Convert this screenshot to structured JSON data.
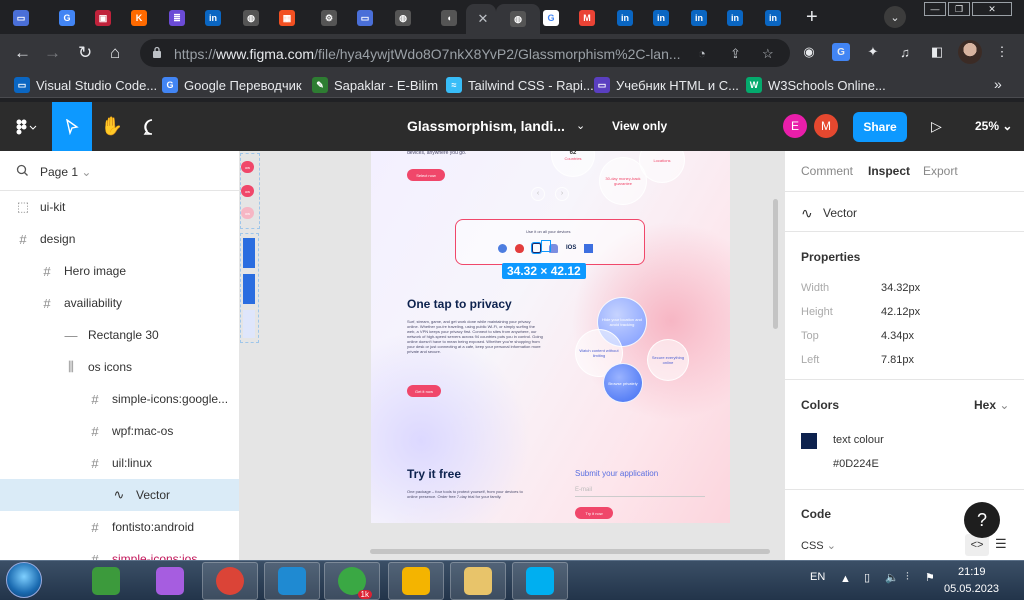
{
  "browser": {
    "tabs": [
      {
        "icon": "laptop-icon",
        "color": "#4a6fd8",
        "glyph": "▭"
      },
      {
        "icon": "google-translate-icon",
        "color": "#4285f4",
        "glyph": "G"
      },
      {
        "icon": "figma-like-icon",
        "color": "#c0223b",
        "glyph": "▣"
      },
      {
        "icon": "k-icon",
        "color": "#ff6a00",
        "glyph": "K"
      },
      {
        "icon": "list-icon",
        "color": "#6b4bd6",
        "glyph": "≣"
      },
      {
        "icon": "linkedin-icon",
        "color": "#0a66c2",
        "glyph": "in"
      },
      {
        "icon": "globe-icon",
        "color": "#555",
        "glyph": "◍"
      },
      {
        "icon": "microsoft-icon",
        "color": "#f25022",
        "glyph": "▦"
      },
      {
        "icon": "gear-icon",
        "color": "#555",
        "glyph": "⚙"
      },
      {
        "icon": "laptop-icon",
        "color": "#4a6fd8",
        "glyph": "▭"
      },
      {
        "icon": "globe-icon",
        "color": "#555",
        "glyph": "◍"
      },
      {
        "icon": "speaker-icon",
        "color": "#555",
        "glyph": "◖"
      },
      {
        "icon": "globe-icon",
        "color": "#555",
        "glyph": "◍"
      },
      {
        "icon": "google-icon",
        "color": "#fff",
        "glyph": "G"
      },
      {
        "icon": "gmail-icon",
        "color": "#ea4335",
        "glyph": "M"
      },
      {
        "icon": "linkedin-icon",
        "color": "#0a66c2",
        "glyph": "in"
      },
      {
        "icon": "linkedin-icon",
        "color": "#0a66c2",
        "glyph": "in"
      },
      {
        "icon": "linkedin-icon",
        "color": "#0a66c2",
        "glyph": "in"
      },
      {
        "icon": "linkedin-icon",
        "color": "#0a66c2",
        "glyph": "in"
      },
      {
        "icon": "linkedin-icon",
        "color": "#0a66c2",
        "glyph": "in"
      }
    ],
    "url_prefix": "https://",
    "url_host": "www.figma.com",
    "url_path": "/file/hya4ywjtWdo8O7nkX8YvP2/Glassmorphism%2C-lan...",
    "bookmarks": [
      {
        "label": "Visual Studio Code...",
        "color": "#0a66c2",
        "glyph": "▭"
      },
      {
        "label": "Google Переводчик",
        "color": "#4285f4",
        "glyph": "G"
      },
      {
        "label": "Sapaklar - E-Bilim",
        "color": "#2e7d32",
        "glyph": "✎"
      },
      {
        "label": "Tailwind CSS - Rapi...",
        "color": "#38bdf8",
        "glyph": "≈"
      },
      {
        "label": "Учебник HTML и C...",
        "color": "#5a3fc0",
        "glyph": "▭"
      },
      {
        "label": "W3Schools Online...",
        "color": "#04aa6d",
        "glyph": "W"
      }
    ],
    "bookmarks_more": "»"
  },
  "figma": {
    "file_title": "Glassmorphism, landi...",
    "view_mode": "View only",
    "avatars": [
      "E",
      "M"
    ],
    "share_label": "Share",
    "zoom": "25%",
    "page_selector": "Page 1",
    "layers": [
      {
        "name": "ui-kit",
        "icon": "dashed-frame-icon",
        "glyph": "⬚",
        "indent": 0
      },
      {
        "name": "design",
        "icon": "frame-icon",
        "glyph": "#",
        "indent": 0
      },
      {
        "name": "Hero image",
        "icon": "frame-icon",
        "glyph": "#",
        "indent": 1
      },
      {
        "name": "availiability",
        "icon": "frame-icon",
        "glyph": "#",
        "indent": 1
      },
      {
        "name": "Rectangle 30",
        "icon": "rectangle-icon",
        "glyph": "—",
        "indent": 2
      },
      {
        "name": "os icons",
        "icon": "auto-layout-icon",
        "glyph": "⫼",
        "indent": 2
      },
      {
        "name": "simple-icons:google...",
        "icon": "frame-icon",
        "glyph": "#",
        "indent": 3
      },
      {
        "name": "wpf:mac-os",
        "icon": "frame-icon",
        "glyph": "#",
        "indent": 3
      },
      {
        "name": "uil:linux",
        "icon": "frame-icon",
        "glyph": "#",
        "indent": 3
      },
      {
        "name": "Vector",
        "icon": "vector-icon",
        "glyph": "∿",
        "indent": 4,
        "selected": true
      },
      {
        "name": "fontisto:android",
        "icon": "frame-icon",
        "glyph": "#",
        "indent": 3
      },
      {
        "name": "simple-icons:ios",
        "icon": "frame-icon",
        "glyph": "#",
        "indent": 3
      }
    ],
    "selection_size": "34.32 × 42.12"
  },
  "design": {
    "hero_tail_text": "devices, anywhere you go.",
    "hero_btn": "Select now",
    "countries_card": "Countries",
    "countries_num": "62",
    "moneyback_card": "30-day money-back guarantee",
    "locations_card": "Locations",
    "devices_caption": "Use it on all your devices",
    "os_ios": "IOS",
    "privacy_title": "One tap to privacy",
    "privacy_body": "Surf, stream, game, and get work done while maintaining your privacy online. Whether you're traveling, using public Wi-Fi, or simply surfing the web, a VPN keeps your privacy first. Connect to sites from anywhere, our network of high-speed servers across 94 countries puts you in control. Going online doesn't have to mean being exposed. Whether you're shopping from your desk or just connecting at a cafe, keep your personal information more private and secure.",
    "privacy_btn": "Get it now",
    "bubbles": [
      "Hide your location and avoid tracking",
      "Watch content without limiting",
      "Secure everything online",
      "Browse privately"
    ],
    "try_title": "Try it free",
    "try_body": "One package – four tools to protect yourself, from your devices to online presence. Order free 7-day trial for your family.",
    "submit_title": "Submit your application",
    "email_placeholder": "E-mail",
    "try_btn": "Try it now"
  },
  "inspect": {
    "tabs": [
      "Comment",
      "Inspect",
      "Export"
    ],
    "active_tab": "Inspect",
    "layer_name": "Vector",
    "properties_title": "Properties",
    "properties": [
      {
        "k": "Width",
        "v": "34.32px"
      },
      {
        "k": "Height",
        "v": "42.12px"
      },
      {
        "k": "Top",
        "v": "4.34px"
      },
      {
        "k": "Left",
        "v": "7.81px"
      }
    ],
    "colors_title": "Colors",
    "color_format": "Hex",
    "color_name": "text colour",
    "color_hex": "#0D224E",
    "code_title": "Code",
    "code_lang": "CSS",
    "help": "?"
  },
  "taskbar": {
    "apps": [
      {
        "icon": "chart-app-icon",
        "color": "#3c9a3c"
      },
      {
        "icon": "gem-app-icon",
        "color": "#a65de0"
      },
      {
        "icon": "chrome-icon",
        "color": "#db4437"
      },
      {
        "icon": "vscode-icon",
        "color": "#1f8ad2"
      },
      {
        "icon": "utorrent-icon",
        "color": "#3aa844",
        "badge": "1k"
      },
      {
        "icon": "google-drive-icon",
        "color": "#f4b400"
      },
      {
        "icon": "file-explorer-icon",
        "color": "#e8c46a"
      },
      {
        "icon": "skype-icon",
        "color": "#00aff0"
      }
    ],
    "language": "EN",
    "time": "21:19",
    "date": "05.05.2023"
  }
}
